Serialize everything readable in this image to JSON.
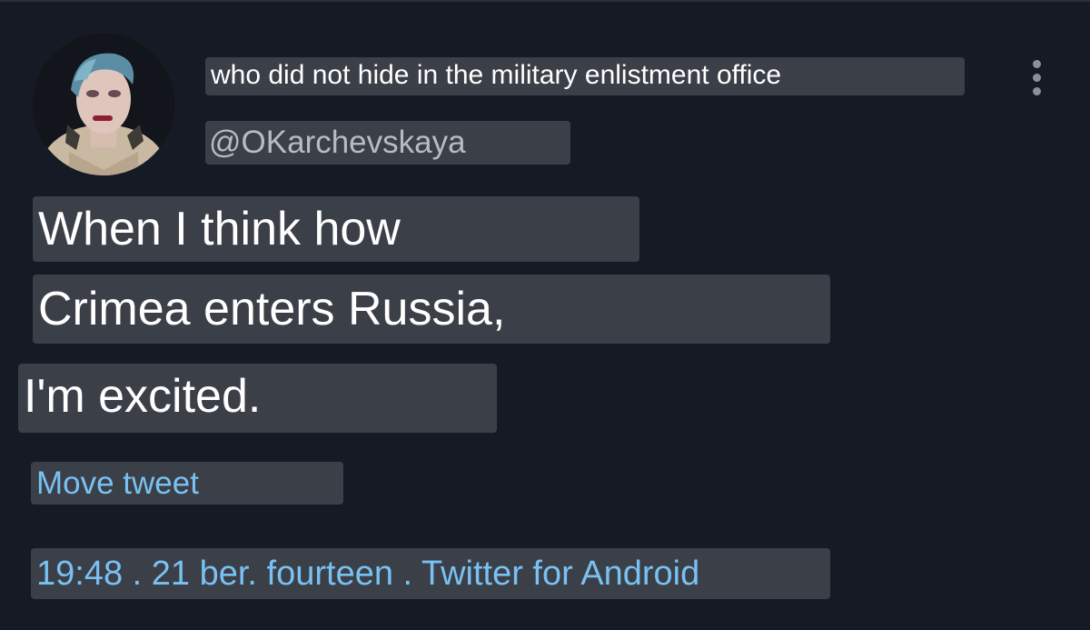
{
  "tweet": {
    "display_name": "who did not hide in the military enlistment office",
    "handle": "@OKarchevskaya",
    "text_lines": [
      "When I think how",
      "Crimea enters Russia,",
      "I'm excited."
    ],
    "move_tweet_label": "Move tweet",
    "timestamp": "19:48 . 21 ber. fourteen . Twitter for Android"
  },
  "icons": {
    "more": "more-vertical-icon",
    "avatar": "user-avatar"
  },
  "colors": {
    "background": "#151a24",
    "label_box": "#3b3f48",
    "text": "#ffffff",
    "handle": "#b7bcc3",
    "link": "#79c1f2"
  }
}
